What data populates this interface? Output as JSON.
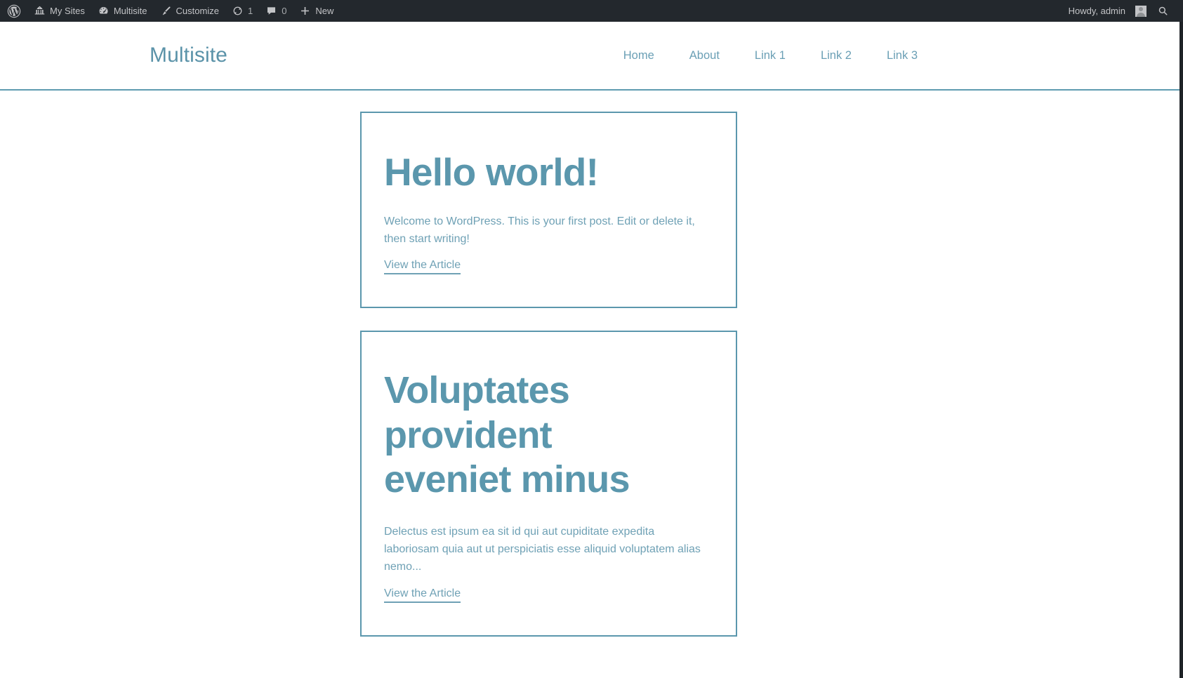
{
  "adminbar": {
    "logo_icon": "wordpress-logo-icon",
    "left_items": [
      {
        "label": "My Sites",
        "icon": "my-sites-icon",
        "name": "adminbar-my-sites"
      },
      {
        "label": "Multisite",
        "icon": "dashboard-icon",
        "name": "adminbar-site-name"
      },
      {
        "label": "Customize",
        "icon": "paintbrush-icon",
        "name": "adminbar-customize"
      },
      {
        "label": "1",
        "icon": "updates-icon",
        "name": "adminbar-updates"
      },
      {
        "label": "0",
        "icon": "comment-bubble-icon",
        "name": "adminbar-comments"
      },
      {
        "label": "New",
        "icon": "plus-icon",
        "name": "adminbar-new-content"
      }
    ],
    "howdy": "Howdy, admin",
    "avatar_icon": "user-avatar-icon",
    "search_icon": "search-icon",
    "bg_color": "#23282d",
    "text_color": "#c3c4c7"
  },
  "header": {
    "site_title": "Multisite",
    "nav": [
      {
        "label": "Home"
      },
      {
        "label": "About"
      },
      {
        "label": "Link 1"
      },
      {
        "label": "Link 2"
      },
      {
        "label": "Link 3"
      }
    ],
    "accent_color": "#5b97ad",
    "border_color": "#5f9bb0"
  },
  "main": {
    "posts": [
      {
        "title": "Hello world!",
        "excerpt": "Welcome to WordPress. This is your first post. Edit or delete it, then start writing!",
        "link_label": "View the Article"
      },
      {
        "title": "Voluptates provident eveniet minus",
        "excerpt": "Delectus est ipsum ea sit id qui aut cupiditate expedita laboriosam quia aut ut perspiciatis esse aliquid voluptatem alias nemo...",
        "link_label": "View the Article"
      }
    ],
    "card_border_color": "#5b97ad",
    "title_color": "#5b97ad",
    "body_color": "#6fa1b5"
  }
}
